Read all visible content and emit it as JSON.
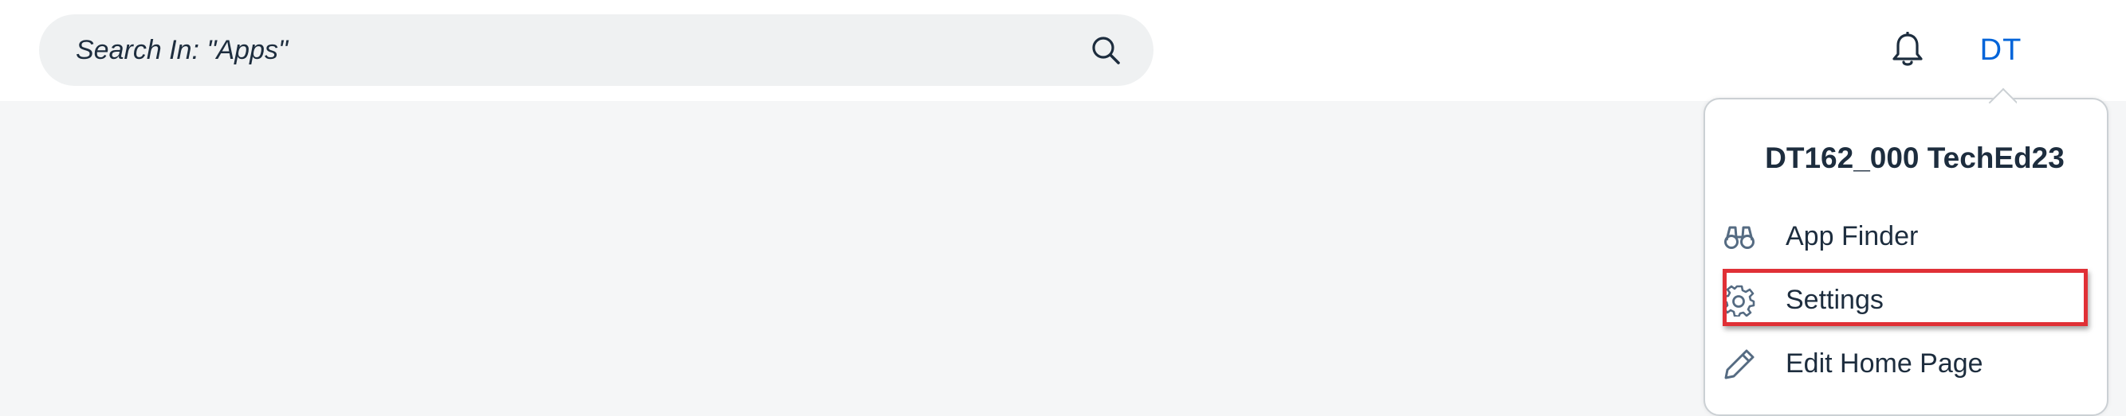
{
  "header": {
    "search": {
      "placeholder": "Search In: \"Apps\"",
      "value": "",
      "icon": "search-icon"
    },
    "notifications_icon": "bell-icon",
    "avatar_initials": "DT",
    "accent_color": "#0064d9"
  },
  "user_menu": {
    "user_name": "DT162_000 TechEd23",
    "items": [
      {
        "label": "App Finder",
        "icon": "binoculars-icon"
      },
      {
        "label": "Settings",
        "icon": "gear-icon",
        "highlighted": true
      },
      {
        "label": "Edit Home Page",
        "icon": "pencil-icon"
      }
    ],
    "highlight_color": "#e03036"
  }
}
